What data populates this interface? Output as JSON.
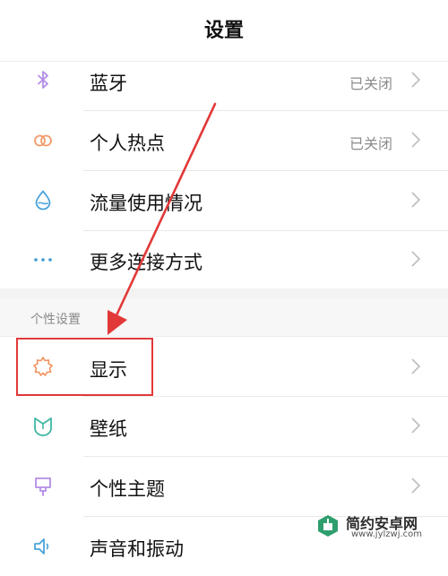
{
  "header": {
    "title": "设置"
  },
  "connectivity": [
    {
      "id": "bluetooth",
      "label": "蓝牙",
      "status": "已关闭",
      "icon": "bluetooth-icon",
      "color": "#b38de6"
    },
    {
      "id": "hotspot",
      "label": "个人热点",
      "status": "已关闭",
      "icon": "hotspot-icon",
      "color": "#f19b68"
    },
    {
      "id": "data-usage",
      "label": "流量使用情况",
      "status": "",
      "icon": "water-drop-icon",
      "color": "#4aa3d9"
    },
    {
      "id": "more-connections",
      "label": "更多连接方式",
      "status": "",
      "icon": "more-dots-icon",
      "color": "#3f97d6"
    }
  ],
  "personalization": {
    "section_label": "个性设置",
    "items": [
      {
        "id": "display",
        "label": "显示",
        "icon": "brightness-icon",
        "color": "#f0925d"
      },
      {
        "id": "wallpaper",
        "label": "壁纸",
        "icon": "wallpaper-icon",
        "color": "#3fb7a2"
      },
      {
        "id": "theme",
        "label": "个性主题",
        "icon": "theme-brush-icon",
        "color": "#b38de6"
      },
      {
        "id": "sound",
        "label": "声音和振动",
        "icon": "speaker-icon",
        "color": "#4aa3d9"
      }
    ]
  },
  "annotation": {
    "highlight_color": "#e23838",
    "target": "显示"
  },
  "watermark": {
    "name": "简约安卓网",
    "url": "www.jylzwj.com"
  }
}
